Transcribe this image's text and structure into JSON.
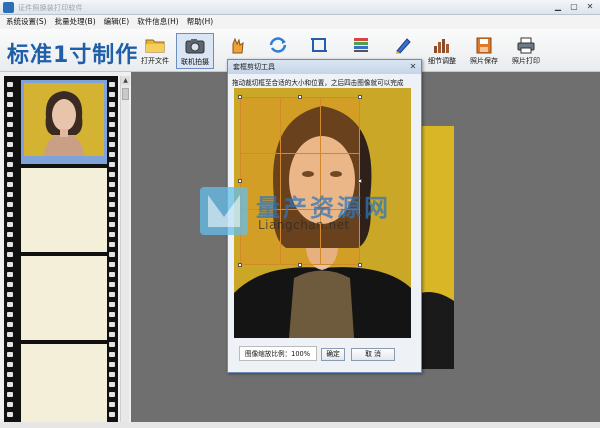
{
  "titlebar": {
    "title": "证件照换装打印软件"
  },
  "menubar": {
    "items": [
      "系统设置(S)",
      "批量处理(B)",
      "编辑(E)",
      "软件信息(H)",
      "帮助(H)"
    ]
  },
  "toolbar": {
    "brand_title": "标准1寸制作",
    "tools": [
      {
        "label": "打开文件",
        "icon": "folder-icon"
      },
      {
        "label": "联机拍摄",
        "icon": "camera-icon"
      },
      {
        "label": "",
        "icon": "hand-icon"
      },
      {
        "label": "",
        "icon": "rotate-icon"
      },
      {
        "label": "",
        "icon": "crop-icon"
      },
      {
        "label": "",
        "icon": "color-bars-icon"
      },
      {
        "label": "",
        "icon": "pen-icon"
      },
      {
        "label": "细节调整",
        "icon": "levels-icon"
      },
      {
        "label": "照片保存",
        "icon": "save-icon"
      },
      {
        "label": "照片打印",
        "icon": "printer-icon"
      }
    ]
  },
  "dialog": {
    "title": "套框剪切工具",
    "hint": "拖动裁切框至合适的大小和位置，之后四击图像就可以完成",
    "zoom_label": "图像缩放比例：",
    "zoom_value": "100%",
    "confirm_label": "确定",
    "cancel_label": "取 消"
  },
  "watermark": {
    "title": "量产资源网",
    "domain": "Liangchan.net"
  },
  "colors": {
    "brand": "#1e5fa8",
    "photo_bg": "#d8b626",
    "crop": "#d3882a"
  }
}
